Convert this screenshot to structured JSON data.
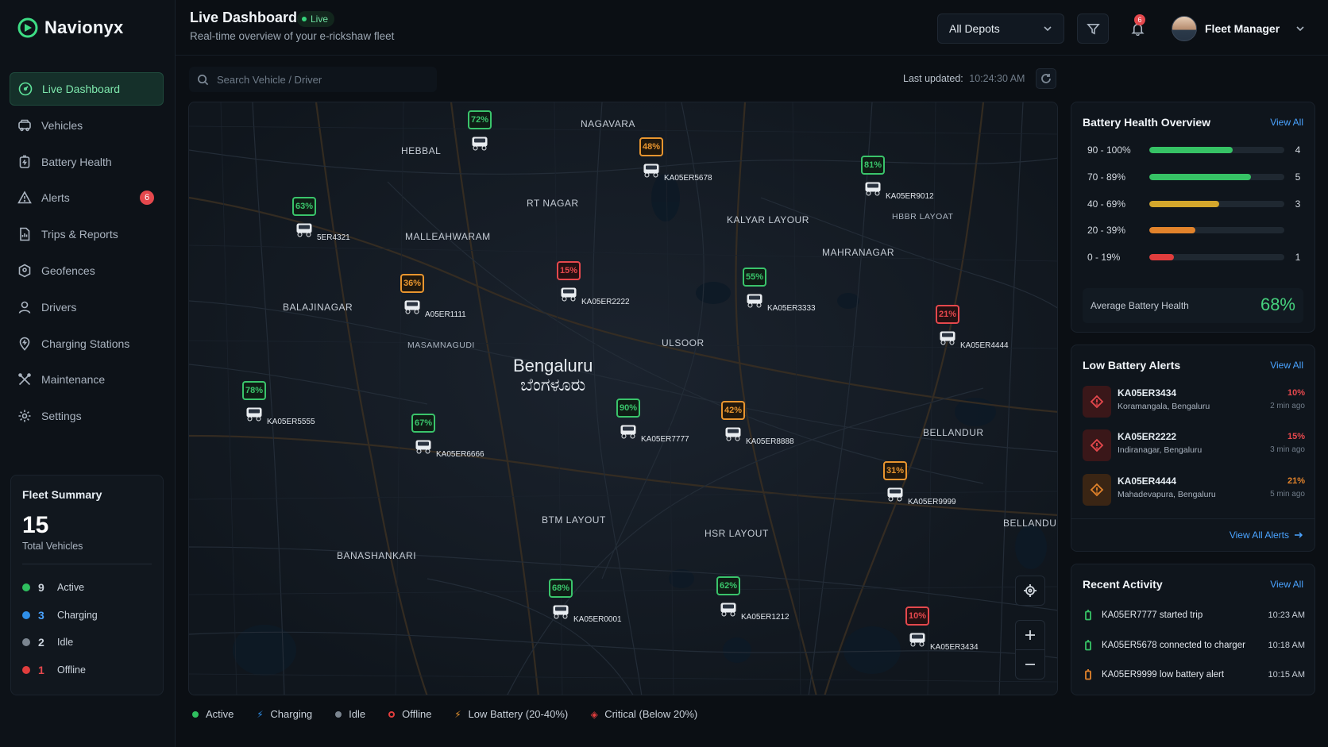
{
  "brand": {
    "name": "Navionyx"
  },
  "sidebar": {
    "items": [
      {
        "label": "Live Dashboard",
        "icon": "gauge-icon",
        "active": true
      },
      {
        "label": "Vehicles",
        "icon": "car-icon"
      },
      {
        "label": "Battery Health",
        "icon": "battery-icon"
      },
      {
        "label": "Alerts",
        "icon": "bell-icon",
        "badge": "6"
      },
      {
        "label": "Trips & Reports",
        "icon": "report-icon"
      },
      {
        "label": "Geofences",
        "icon": "geofence-icon"
      },
      {
        "label": "Drivers",
        "icon": "user-icon"
      },
      {
        "label": "Charging Stations",
        "icon": "charging-icon"
      },
      {
        "label": "Maintenance",
        "icon": "wrench-icon"
      },
      {
        "label": "Settings",
        "icon": "gear-icon"
      }
    ]
  },
  "fleet_summary": {
    "title": "Fleet Summary",
    "total": "15",
    "total_label": "Total Vehicles",
    "rows": [
      {
        "count": "9",
        "label": "Active",
        "color": "#2fbf5f"
      },
      {
        "count": "3",
        "label": "Charging",
        "color": "#2f8fe8"
      },
      {
        "count": "2",
        "label": "Idle",
        "color": "#7b8590"
      },
      {
        "count": "1",
        "label": "Offline",
        "color": "#e03d3d"
      }
    ]
  },
  "header": {
    "title": "Live Dashboard",
    "live_label": "Live",
    "subtitle": "Real-time overview of your e-rickshaw fleet",
    "depot_select": "All Depots",
    "notification_count": "6",
    "user_name": "Fleet Manager"
  },
  "toolbar": {
    "search_placeholder": "Search Vehicle / Driver",
    "last_updated_label": "Last updated:",
    "last_updated_time": "10:24:30 AM"
  },
  "map": {
    "city": "Bengaluru",
    "city_local": "ಬೆಂಗಳೂರು",
    "areas": [
      {
        "label": "NAGAVARA"
      },
      {
        "label": "HEBBAL"
      },
      {
        "label": "RT NAGAR"
      },
      {
        "label": "KALYAR LAYOUR"
      },
      {
        "label": "HBBR LAYOAT"
      },
      {
        "label": "MALLEAHWARAM"
      },
      {
        "label": "MAHRANAGAR"
      },
      {
        "label": "BALAJINAGAR"
      },
      {
        "label": "MASAMNAGUDI"
      },
      {
        "label": "ULSOOR"
      },
      {
        "label": "BELLANDUR"
      },
      {
        "label": "BTM LAYOUT"
      },
      {
        "label": "HSR LAYOUT"
      },
      {
        "label": "BANASHANKARI"
      },
      {
        "label": "BELLANDUR"
      }
    ],
    "vehicles": [
      {
        "pct": "72%",
        "plate": "",
        "status": "active"
      },
      {
        "pct": "48%",
        "plate": "KA05ER5678",
        "status": "low"
      },
      {
        "pct": "81%",
        "plate": "KA05ER9012",
        "status": "active"
      },
      {
        "pct": "63%",
        "plate": "5ER4321",
        "status": "active"
      },
      {
        "pct": "36%",
        "plate": "A05ER1111",
        "status": "low"
      },
      {
        "pct": "15%",
        "plate": "KA05ER2222",
        "status": "critical"
      },
      {
        "pct": "55%",
        "plate": "KA05ER3333",
        "status": "active"
      },
      {
        "pct": "21%",
        "plate": "KA05ER4444",
        "status": "critical"
      },
      {
        "pct": "78%",
        "plate": "KA05ER5555",
        "status": "active"
      },
      {
        "pct": "67%",
        "plate": "KA05ER6666",
        "status": "active"
      },
      {
        "pct": "90%",
        "plate": "KA05ER7777",
        "status": "active"
      },
      {
        "pct": "42%",
        "plate": "KA05ER8888",
        "status": "low"
      },
      {
        "pct": "31%",
        "plate": "KA05ER9999",
        "status": "low"
      },
      {
        "pct": "68%",
        "plate": "KA05ER0001",
        "status": "active"
      },
      {
        "pct": "62%",
        "plate": "KA05ER1212",
        "status": "active"
      },
      {
        "pct": "10%",
        "plate": "KA05ER3434",
        "status": "critical"
      }
    ]
  },
  "legend": [
    {
      "label": "Active",
      "symbol": "dot",
      "color": "#2fbf5f"
    },
    {
      "label": "Charging",
      "symbol": "bolt",
      "color": "#2f8fe8"
    },
    {
      "label": "Idle",
      "symbol": "dot",
      "color": "#7b8590"
    },
    {
      "label": "Offline",
      "symbol": "ring",
      "color": "#e03d3d"
    },
    {
      "label": "Low Battery (20-40%)",
      "symbol": "bolt",
      "color": "#e8952f"
    },
    {
      "label": "Critical (Below 20%)",
      "symbol": "diamond",
      "color": "#e03d3d"
    }
  ],
  "battery_health": {
    "title": "Battery Health Overview",
    "view_all": "View All",
    "rows": [
      {
        "range": "90 - 100%",
        "fill": 0.62,
        "count": "4",
        "color": "#36c265"
      },
      {
        "range": "70 - 89%",
        "fill": 0.75,
        "count": "5",
        "color": "#36c265"
      },
      {
        "range": "40 - 69%",
        "fill": 0.52,
        "count": "3",
        "color": "#d4a72c"
      },
      {
        "range": "20 - 39%",
        "fill": 0.34,
        "count": "",
        "color": "#e2832b"
      },
      {
        "range": "0 - 19%",
        "fill": 0.18,
        "count": "1",
        "color": "#e03d3d"
      }
    ],
    "avg_label": "Average Battery Health",
    "avg_value": "68%"
  },
  "low_battery": {
    "title": "Low Battery Alerts",
    "view_all": "View All",
    "view_all_alerts": "View All Alerts",
    "items": [
      {
        "plate": "KA05ER3434",
        "location": "Koramangala, Bengaluru",
        "pct": "10%",
        "time": "2 min ago",
        "color": "#e03d3d"
      },
      {
        "plate": "KA05ER2222",
        "location": "Indiranagar, Bengaluru",
        "pct": "15%",
        "time": "3 min ago",
        "color": "#e03d3d"
      },
      {
        "plate": "KA05ER4444",
        "location": "Mahadevapura, Bengaluru",
        "pct": "21%",
        "time": "5 min ago",
        "color": "#e2832b"
      }
    ]
  },
  "recent_activity": {
    "title": "Recent Activity",
    "view_all": "View All",
    "items": [
      {
        "text": "KA05ER7777 started trip",
        "time": "10:23 AM",
        "color": "#36c265"
      },
      {
        "text": "KA05ER5678 connected to charger",
        "time": "10:18 AM",
        "color": "#36c265"
      },
      {
        "text": "KA05ER9999 low battery alert",
        "time": "10:15 AM",
        "color": "#e2832b"
      }
    ]
  }
}
